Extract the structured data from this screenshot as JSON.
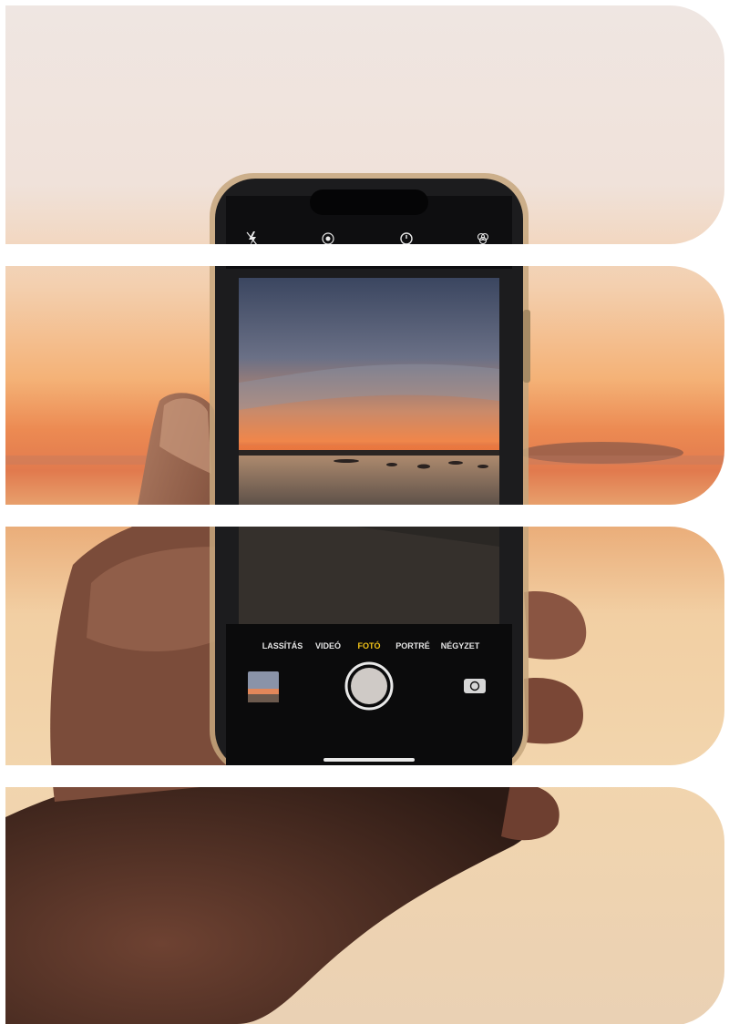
{
  "camera_modes": {
    "slow": "LASSÍTÁS",
    "video": "VIDEÓ",
    "photo": "FOTÓ",
    "portrait": "PORTRÉ",
    "square": "NÉGYZET"
  },
  "colors": {
    "photo_mode_accent": "#f5c518",
    "background": "#ffffff"
  },
  "icons": [
    "flash-off-icon",
    "live-photo-icon",
    "timer-icon",
    "filters-icon",
    "shutter-button",
    "switch-camera-icon",
    "last-photo-thumbnail"
  ]
}
